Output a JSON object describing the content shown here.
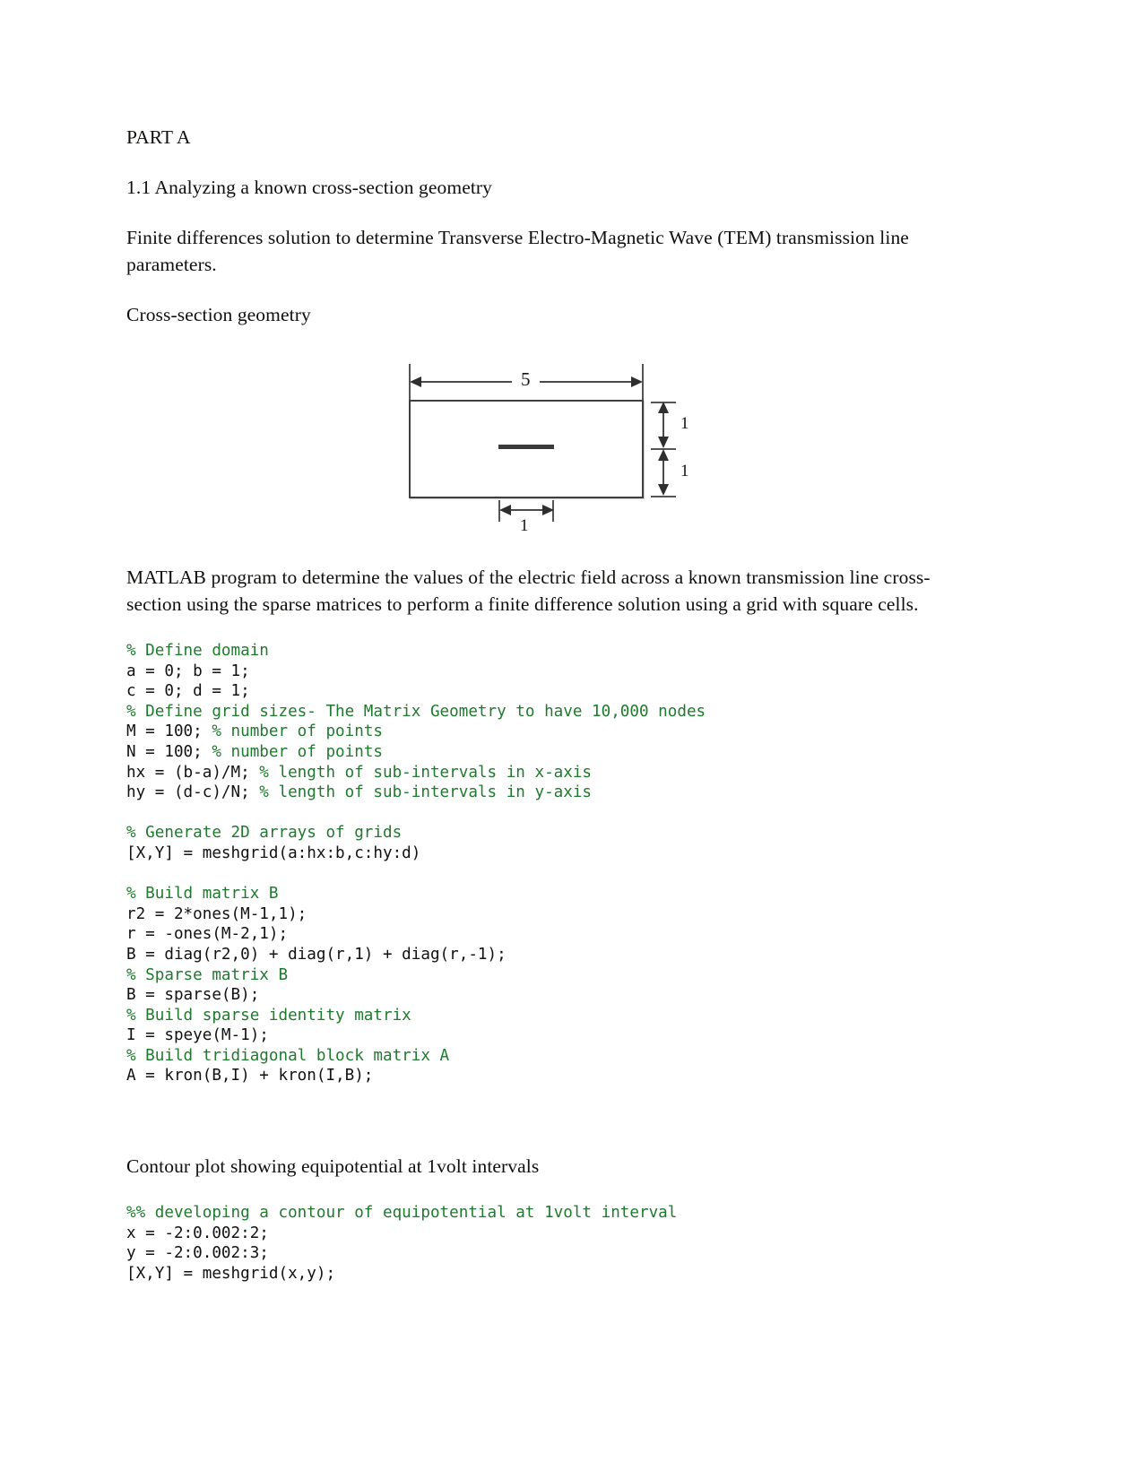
{
  "document": {
    "headings": {
      "part": "PART A",
      "section": "1.1 Analyzing a known cross-section geometry",
      "cross_section_label": "Cross-section geometry",
      "contour_heading": "Contour plot showing equipotential at 1volt intervals"
    },
    "paragraphs": {
      "intro": "Finite differences solution to determine Transverse Electro-Magnetic Wave (TEM) transmission line parameters.",
      "matlab_description": "MATLAB program to determine the values of the electric field across a known transmission line cross-section using the sparse matrices to perform a finite difference solution using a grid with square cells."
    }
  },
  "figure": {
    "name": "cross-section-geometry-diagram",
    "dimensions": {
      "width_label": "5",
      "height_upper_label": "1",
      "height_lower_label": "1",
      "inner_width_label": "1"
    }
  },
  "code_block_1": {
    "lines": [
      {
        "comment": "% Define domain",
        "code": ""
      },
      {
        "comment": "",
        "code": "a = 0; b = 1;"
      },
      {
        "comment": "",
        "code": "c = 0; d = 1;"
      },
      {
        "comment": "% Define grid sizes- The Matrix Geometry to have 10,000 nodes",
        "code": ""
      },
      {
        "comment": "% number of points",
        "code": "M = 100; "
      },
      {
        "comment": "% number of points",
        "code": "N = 100; "
      },
      {
        "comment": "% length of sub-intervals in x-axis",
        "code": "hx = (b-a)/M; "
      },
      {
        "comment": "% length of sub-intervals in y-axis",
        "code": "hy = (d-c)/N; "
      },
      {
        "comment": "",
        "code": ""
      },
      {
        "comment": "% Generate 2D arrays of grids",
        "code": ""
      },
      {
        "comment": "",
        "code": "[X,Y] = meshgrid(a:hx:b,c:hy:d)"
      },
      {
        "comment": "",
        "code": ""
      },
      {
        "comment": "% Build matrix B",
        "code": ""
      },
      {
        "comment": "",
        "code": "r2 = 2*ones(M-1,1);"
      },
      {
        "comment": "",
        "code": "r = -ones(M-2,1);"
      },
      {
        "comment": "",
        "code": "B = diag(r2,0) + diag(r,1) + diag(r,-1);"
      },
      {
        "comment": "% Sparse matrix B",
        "code": ""
      },
      {
        "comment": "",
        "code": "B = sparse(B);"
      },
      {
        "comment": "% Build sparse identity matrix",
        "code": ""
      },
      {
        "comment": "",
        "code": "I = speye(M-1);"
      },
      {
        "comment": "% Build tridiagonal block matrix A",
        "code": ""
      },
      {
        "comment": "",
        "code": "A = kron(B,I) + kron(I,B);"
      }
    ],
    "text": "% Define domain\na = 0; b = 1;\nc = 0; d = 1;\n% Define grid sizes- The Matrix Geometry to have 10,000 nodes\nM = 100; % number of points\nN = 100; % number of points\nhx = (b-a)/M; % length of sub-intervals in x-axis\nhy = (d-c)/N; % length of sub-intervals in y-axis\n\n% Generate 2D arrays of grids\n[X,Y] = meshgrid(a:hx:b,c:hy:d)\n\n% Build matrix B\nr2 = 2*ones(M-1,1);\nr = -ones(M-2,1);\nB = diag(r2,0) + diag(r,1) + diag(r,-1);\n% Sparse matrix B\nB = sparse(B);\n% Build sparse identity matrix\nI = speye(M-1);\n% Build tridiagonal block matrix A\nA = kron(B,I) + kron(I,B);"
  },
  "code_block_2": {
    "lines": [
      {
        "comment": "%% developing a contour of equipotential at 1volt interval",
        "code": ""
      },
      {
        "comment": "",
        "code": "x = -2:0.002:2;"
      },
      {
        "comment": "",
        "code": "y = -2:0.002:3;"
      },
      {
        "comment": "",
        "code": "[X,Y] = meshgrid(x,y);"
      }
    ],
    "text": "%% developing a contour of equipotential at 1volt interval\nx = -2:0.002:2;\ny = -2:0.002:3;\n[X,Y] = meshgrid(x,y);"
  },
  "colors": {
    "comment_green": "#1f7a2e",
    "code_black": "#111111",
    "body_text": "#100f0d"
  }
}
